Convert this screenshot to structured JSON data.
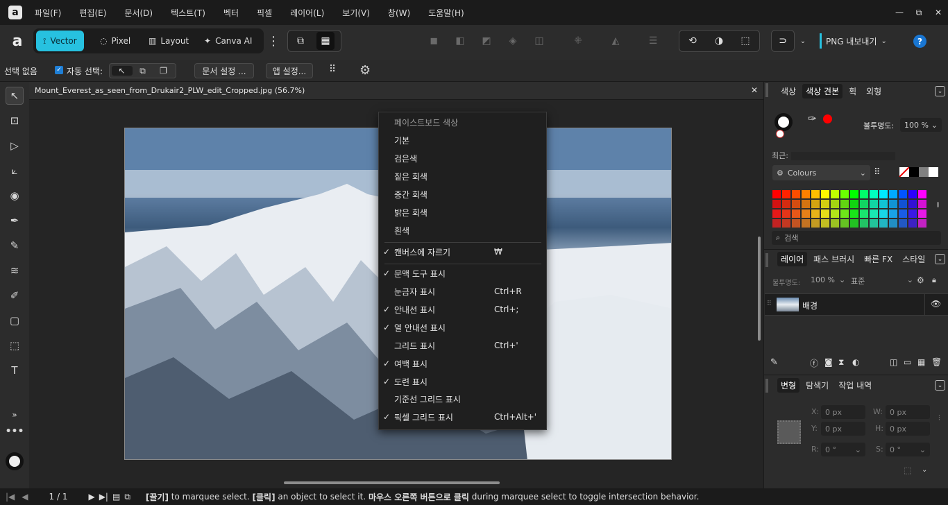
{
  "menubar": {
    "logo": "a",
    "items": [
      "파일(F)",
      "편집(E)",
      "문서(D)",
      "텍스트(T)",
      "벡터",
      "픽셀",
      "레이어(L)",
      "보기(V)",
      "창(W)",
      "도움말(H)"
    ],
    "window_controls": [
      "—",
      "⧉",
      "✕"
    ]
  },
  "toolbar": {
    "personas": [
      {
        "label": "Vector",
        "active": true
      },
      {
        "label": "Pixel",
        "active": false
      },
      {
        "label": "Layout",
        "active": false
      },
      {
        "label": "Canva AI",
        "active": false
      }
    ],
    "more": "⋮",
    "export_label": "PNG 내보내기",
    "help": "?"
  },
  "context": {
    "selection": "선택 없음",
    "auto_select": "자동 선택:",
    "doc_settings": "문서 설정 ...",
    "app_settings": "앱 설정..."
  },
  "document": {
    "tab_title": "Mount_Everest_as_seen_from_Drukair2_PLW_edit_Cropped.jpg (56.7%)",
    "close": "✕"
  },
  "context_menu": {
    "header": "페이스트보드 색상",
    "items": [
      {
        "label": "기본",
        "check": false,
        "shortcut": ""
      },
      {
        "label": "검은색",
        "check": false,
        "shortcut": ""
      },
      {
        "label": "짙은 회색",
        "check": false,
        "shortcut": ""
      },
      {
        "label": "중간 회색",
        "check": false,
        "shortcut": ""
      },
      {
        "label": "밝은 회색",
        "check": false,
        "shortcut": ""
      },
      {
        "label": "흰색",
        "check": false,
        "shortcut": ""
      },
      {
        "label": "캔버스에 자르기",
        "check": true,
        "shortcut": "₩"
      },
      {
        "label": "문맥 도구 표시",
        "check": true,
        "shortcut": ""
      },
      {
        "label": "눈금자 표시",
        "check": false,
        "shortcut": "Ctrl+R"
      },
      {
        "label": "안내선 표시",
        "check": true,
        "shortcut": "Ctrl+;"
      },
      {
        "label": "열 안내선 표시",
        "check": true,
        "shortcut": ""
      },
      {
        "label": "그리드 표시",
        "check": false,
        "shortcut": "Ctrl+'"
      },
      {
        "label": "여백 표시",
        "check": true,
        "shortcut": ""
      },
      {
        "label": "도련 표시",
        "check": true,
        "shortcut": ""
      },
      {
        "label": "기준선 그리드 표시",
        "check": false,
        "shortcut": ""
      },
      {
        "label": "픽셀 그리드 표시",
        "check": true,
        "shortcut": "Ctrl+Alt+'"
      }
    ]
  },
  "color_panel": {
    "tabs": [
      "색상",
      "색상 견본",
      "획",
      "외형"
    ],
    "active_tab": "색상 견본",
    "opacity_label": "불투명도:",
    "opacity_value": "100 %",
    "recent_label": "최근:",
    "palette_name": "Colours",
    "search_placeholder": "검색"
  },
  "layers_panel": {
    "tabs": [
      "레이어",
      "패스 브러시",
      "빠른 FX",
      "스타일"
    ],
    "active_tab": "레이어",
    "opacity_label": "불투명도:",
    "opacity_value": "100 %",
    "blend_mode": "표준",
    "layer_name": "배경"
  },
  "transform_panel": {
    "tabs": [
      "변형",
      "탐색기",
      "작업 내역"
    ],
    "active_tab": "변형",
    "x_label": "X:",
    "x_value": "0 px",
    "y_label": "Y:",
    "y_value": "0 px",
    "w_label": "W:",
    "w_value": "0 px",
    "h_label": "H:",
    "h_value": "0 px",
    "r_label": "R:",
    "r_value": "0 °",
    "s_label": "S:",
    "s_value": "0 °"
  },
  "statusbar": {
    "page": "1 / 1",
    "hint_drag_bold": "[끌기]",
    "hint_drag": " to marquee select. ",
    "hint_click_bold": "[클릭]",
    "hint_click": " an object to select it. ",
    "hint_right_bold": "마우스 오른쪽 버튼으로 클릭",
    "hint_right": " during marquee select to toggle intersection behavior."
  },
  "colors": {
    "accent": "#27c1e0",
    "menu_bg": "#1f1f1f",
    "panel_bg": "#2c2c2c"
  }
}
